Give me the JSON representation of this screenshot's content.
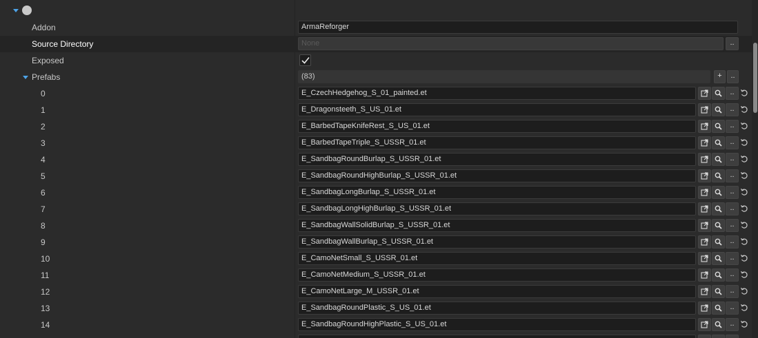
{
  "properties": {
    "addon": {
      "label": "Addon",
      "value": "ArmaReforger"
    },
    "source_directory": {
      "label": "Source Directory",
      "placeholder": "None",
      "browse_label": ".."
    },
    "exposed": {
      "label": "Exposed",
      "checked": true
    },
    "prefabs": {
      "label": "Prefabs",
      "count": "(83)",
      "add_label": "+",
      "more_label": "..",
      "items": [
        {
          "index": "0",
          "value": "E_CzechHedgehog_S_01_painted.et"
        },
        {
          "index": "1",
          "value": "E_Dragonsteeth_S_US_01.et"
        },
        {
          "index": "2",
          "value": "E_BarbedTapeKnifeRest_S_US_01.et"
        },
        {
          "index": "3",
          "value": "E_BarbedTapeTriple_S_USSR_01.et"
        },
        {
          "index": "4",
          "value": "E_SandbagRoundBurlap_S_USSR_01.et"
        },
        {
          "index": "5",
          "value": "E_SandbagRoundHighBurlap_S_USSR_01.et"
        },
        {
          "index": "6",
          "value": "E_SandbagLongBurlap_S_USSR_01.et"
        },
        {
          "index": "7",
          "value": "E_SandbagLongHighBurlap_S_USSR_01.et"
        },
        {
          "index": "8",
          "value": "E_SandbagWallSolidBurlap_S_USSR_01.et"
        },
        {
          "index": "9",
          "value": "E_SandbagWallBurlap_S_USSR_01.et"
        },
        {
          "index": "10",
          "value": "E_CamoNetSmall_S_USSR_01.et"
        },
        {
          "index": "11",
          "value": "E_CamoNetMedium_S_USSR_01.et"
        },
        {
          "index": "12",
          "value": "E_CamoNetLarge_M_USSR_01.et"
        },
        {
          "index": "13",
          "value": "E_SandbagRoundPlastic_S_US_01.et"
        },
        {
          "index": "14",
          "value": "E_SandbagRoundHighPlastic_S_US_01.et"
        }
      ],
      "item_browse_label": ".."
    }
  },
  "colors": {
    "background": "#2b2b2b",
    "accent": "#4da3e8",
    "field": "#1d1d1d",
    "selected_row": "#242424"
  },
  "icons": {
    "expand": "triangle-down-icon",
    "entity": "circle-icon",
    "open": "open-external-icon",
    "find": "magnifier-icon",
    "reset": "reset-arrow-icon",
    "check": "checkmark-icon"
  }
}
